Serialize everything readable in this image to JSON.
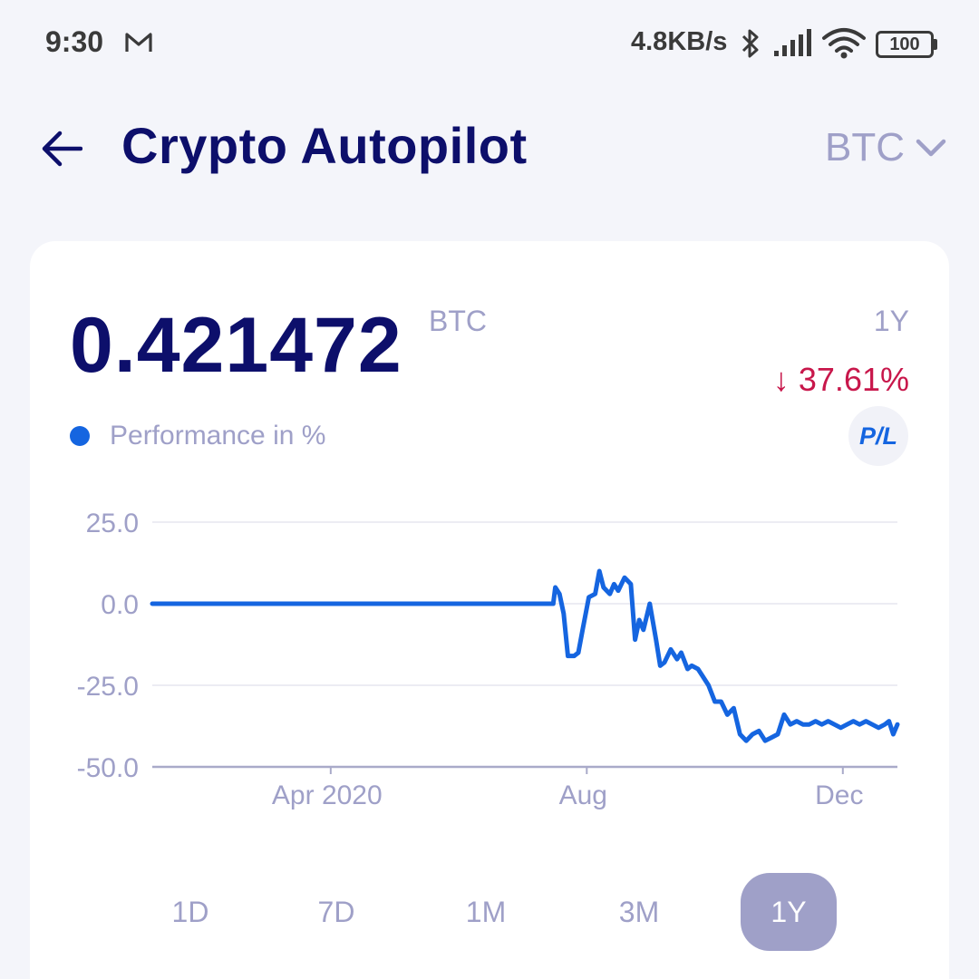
{
  "status_bar": {
    "time": "9:30",
    "network_speed": "4.8KB/s",
    "battery": "100",
    "icons": [
      "gmail-icon",
      "bluetooth-icon",
      "signal-icon",
      "wifi-icon",
      "battery-icon"
    ]
  },
  "header": {
    "title": "Crypto Autopilot",
    "currency": "BTC",
    "back_icon": "arrow-left-icon",
    "dropdown_icon": "chevron-down-icon"
  },
  "summary": {
    "balance": "0.421472",
    "unit": "BTC",
    "period": "1Y",
    "change": "↓ 37.61%",
    "legend": "Performance in %",
    "pl_label": "P/L"
  },
  "colors": {
    "accent": "#1565e0",
    "title": "#0d0f6b",
    "muted": "#9fa0c8",
    "negative": "#c8174b"
  },
  "range_tabs": [
    "1D",
    "7D",
    "1M",
    "3M",
    "1Y"
  ],
  "active_range": "1Y",
  "chart_data": {
    "type": "line",
    "ylim": [
      -50,
      25
    ],
    "yticks": [
      25,
      0,
      -25,
      -50
    ],
    "ytick_labels": [
      "25.0",
      "0.0",
      "-25.0",
      "-50.0"
    ],
    "xlim": [
      "2020-01-07",
      "2020-12-27"
    ],
    "xticks": [
      "2020-04-01",
      "2020-08-01",
      "2020-12-01"
    ],
    "xtick_labels": [
      "Apr 2020",
      "Aug",
      "Dec"
    ],
    "grid": true,
    "series": [
      {
        "color": "#1565e0",
        "x": [
          "2020-01-07",
          "2020-07-16",
          "2020-07-17",
          "2020-07-19",
          "2020-07-21",
          "2020-07-23",
          "2020-07-26",
          "2020-07-28",
          "2020-07-30",
          "2020-08-02",
          "2020-08-05",
          "2020-08-07",
          "2020-08-09",
          "2020-08-12",
          "2020-08-14",
          "2020-08-16",
          "2020-08-19",
          "2020-08-22",
          "2020-08-24",
          "2020-08-26",
          "2020-08-28",
          "2020-08-31",
          "2020-09-03",
          "2020-09-05",
          "2020-09-07",
          "2020-09-10",
          "2020-09-13",
          "2020-09-15",
          "2020-09-18",
          "2020-09-20",
          "2020-09-23",
          "2020-09-25",
          "2020-09-28",
          "2020-10-01",
          "2020-10-04",
          "2020-10-07",
          "2020-10-10",
          "2020-10-13",
          "2020-10-16",
          "2020-10-19",
          "2020-10-22",
          "2020-10-25",
          "2020-10-28",
          "2020-10-31",
          "2020-11-03",
          "2020-11-06",
          "2020-11-09",
          "2020-11-12",
          "2020-11-15",
          "2020-11-18",
          "2020-11-21",
          "2020-11-24",
          "2020-11-27",
          "2020-11-30",
          "2020-12-03",
          "2020-12-06",
          "2020-12-09",
          "2020-12-12",
          "2020-12-15",
          "2020-12-18",
          "2020-12-21",
          "2020-12-23",
          "2020-12-25",
          "2020-12-27"
        ],
        "y": [
          0,
          0,
          5,
          3,
          -3,
          -16,
          -16,
          -15,
          -8,
          2,
          3,
          10,
          5,
          3,
          6,
          4,
          8,
          6,
          -11,
          -5,
          -8,
          0,
          -11,
          -19,
          -18,
          -14,
          -17,
          -15,
          -20,
          -19,
          -20,
          -22,
          -25,
          -30,
          -30,
          -34,
          -32,
          -40,
          -42,
          -40,
          -39,
          -42,
          -41,
          -40,
          -34,
          -37,
          -36,
          -37,
          -37,
          -36,
          -37,
          -36,
          -37,
          -38,
          -37,
          -36,
          -37,
          -36,
          -37,
          -38,
          -37,
          -36,
          -40,
          -37
        ]
      }
    ]
  }
}
